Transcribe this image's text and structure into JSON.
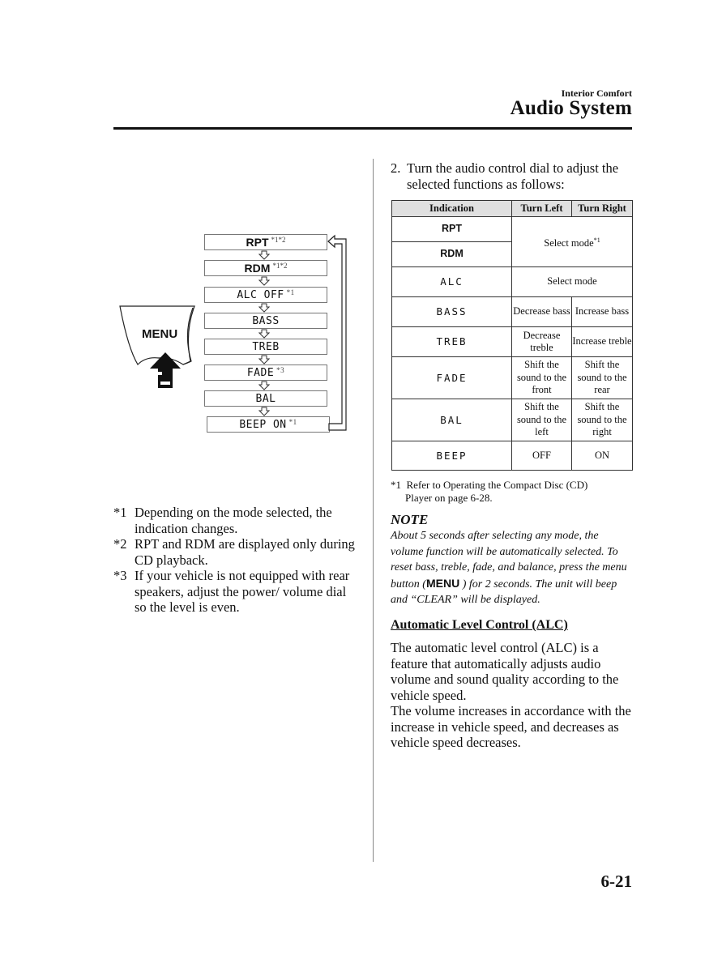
{
  "header": {
    "section": "Interior Comfort",
    "title": "Audio System",
    "page_number": "6-21"
  },
  "diagram": {
    "menu_button_label": "MENU",
    "flow": [
      {
        "label": "RPT",
        "note": "*1*2",
        "style": "bold"
      },
      {
        "label": "RDM",
        "note": "*1*2",
        "style": "bold"
      },
      {
        "label": "ALC OFF",
        "note": "*1",
        "style": "lcd"
      },
      {
        "label": "BASS",
        "note": "",
        "style": "lcd"
      },
      {
        "label": "TREB",
        "note": "",
        "style": "lcd"
      },
      {
        "label": "FADE",
        "note": "*3",
        "style": "lcd"
      },
      {
        "label": "BAL",
        "note": "",
        "style": "lcd"
      },
      {
        "label": "BEEP ON",
        "note": "*1",
        "style": "lcd"
      }
    ]
  },
  "left_footnotes": [
    {
      "mark": "*1",
      "text": "Depending on the mode selected, the indication changes."
    },
    {
      "mark": "*2",
      "text": "RPT and RDM are displayed only during CD playback."
    },
    {
      "mark": "*3",
      "text": "If your vehicle is not equipped with rear speakers, adjust the power/ volume dial so the level is even."
    }
  ],
  "step": {
    "number": "2.",
    "text_line1": "Turn the audio control dial to adjust the",
    "text_line2": "selected functions as follows:"
  },
  "table": {
    "headers": [
      "Indication",
      "Turn Left",
      "Turn Right"
    ],
    "rows": {
      "rpt": {
        "indication": "RPT"
      },
      "rdm": {
        "indication": "RDM"
      },
      "rpt_rdm_action": "Select mode",
      "rpt_rdm_note": "*1",
      "alc": {
        "indication": "ALC",
        "action": "Select mode"
      },
      "bass": {
        "indication": "BASS",
        "left": "Decrease bass",
        "right": "Increase bass"
      },
      "treb": {
        "indication": "TREB",
        "left": "Decrease treble",
        "right": "Increase treble"
      },
      "fade": {
        "indication": "FADE",
        "left": "Shift the sound to the front",
        "right": "Shift the sound to the rear"
      },
      "bal": {
        "indication": "BAL",
        "left": "Shift the sound to the left",
        "right": "Shift the sound to the right"
      },
      "beep": {
        "indication": "BEEP",
        "left": "OFF",
        "right": "ON"
      }
    }
  },
  "table_footnote": {
    "mark": "*1",
    "line1": "Refer to Operating the Compact Disc (CD)",
    "line2": "Player on page 6-28."
  },
  "note": {
    "title": "NOTE",
    "part1": "About 5 seconds after selecting any mode, the volume function will be automatically selected. To reset bass, treble, fade, and balance, press the menu button (",
    "menu_label": "MENU",
    "part2": " ) for 2 seconds. The unit will beep and “CLEAR” will be displayed."
  },
  "alc_section": {
    "heading": "Automatic Level Control (ALC)",
    "paragraph1": "The automatic level control (ALC) is a feature that automatically adjusts audio volume and sound quality according to the vehicle speed.",
    "paragraph2": "The volume increases in accordance with the increase in vehicle speed, and decreases as vehicle speed decreases."
  }
}
